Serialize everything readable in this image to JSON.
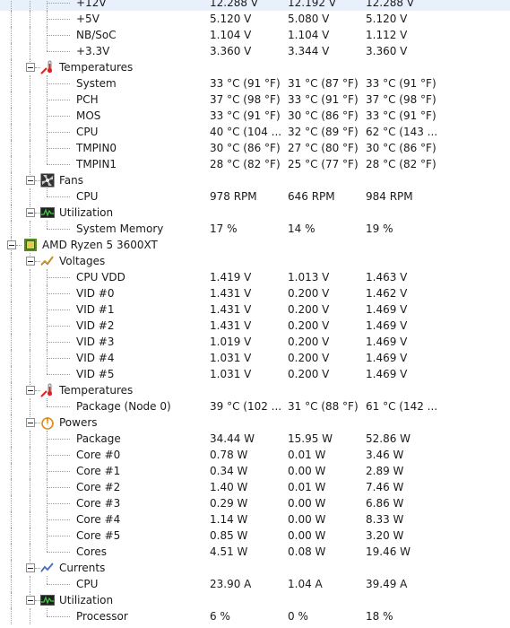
{
  "rows": [
    {
      "type": "data",
      "indent": 2,
      "label": "+12V",
      "values": [
        "12.288 V",
        "12.192 V",
        "12.288 V"
      ]
    },
    {
      "type": "data",
      "indent": 2,
      "label": "+5V",
      "values": [
        "5.120 V",
        "5.080 V",
        "5.120 V"
      ]
    },
    {
      "type": "data",
      "indent": 2,
      "label": "NB/SoC",
      "values": [
        "1.104 V",
        "1.104 V",
        "1.112 V"
      ]
    },
    {
      "type": "data",
      "indent": 2,
      "label": "+3.3V",
      "values": [
        "3.360 V",
        "3.344 V",
        "3.360 V"
      ]
    },
    {
      "type": "group",
      "indent": 1,
      "icon": "thermometer-icon",
      "label": "Temperatures"
    },
    {
      "type": "data",
      "indent": 2,
      "label": "System",
      "values": [
        "33 °C  (91 °F)",
        "31 °C  (87 °F)",
        "33 °C  (91 °F)"
      ]
    },
    {
      "type": "data",
      "indent": 2,
      "label": "PCH",
      "values": [
        "37 °C  (98 °F)",
        "33 °C  (91 °F)",
        "37 °C  (98 °F)"
      ]
    },
    {
      "type": "data",
      "indent": 2,
      "label": "MOS",
      "values": [
        "33 °C  (91 °F)",
        "30 °C  (86 °F)",
        "33 °C  (91 °F)"
      ]
    },
    {
      "type": "data",
      "indent": 2,
      "label": "CPU",
      "values": [
        "40 °C  (104 ...",
        "32 °C  (89 °F)",
        "62 °C  (143 ..."
      ]
    },
    {
      "type": "data",
      "indent": 2,
      "label": "TMPIN0",
      "values": [
        "30 °C  (86 °F)",
        "27 °C  (80 °F)",
        "30 °C  (86 °F)"
      ]
    },
    {
      "type": "data",
      "indent": 2,
      "label": "TMPIN1",
      "values": [
        "28 °C  (82 °F)",
        "25 °C  (77 °F)",
        "28 °C  (82 °F)"
      ]
    },
    {
      "type": "group",
      "indent": 1,
      "icon": "fan-icon",
      "label": "Fans"
    },
    {
      "type": "data",
      "indent": 2,
      "label": "CPU",
      "values": [
        "978 RPM",
        "646 RPM",
        "984 RPM"
      ]
    },
    {
      "type": "group",
      "indent": 1,
      "icon": "utilization-icon",
      "label": "Utilization"
    },
    {
      "type": "data",
      "indent": 2,
      "label": "System Memory",
      "values": [
        "17 %",
        "14 %",
        "19 %"
      ]
    },
    {
      "type": "group",
      "indent": 0,
      "icon": "cpu-chip-icon",
      "label": "AMD Ryzen 5 3600XT"
    },
    {
      "type": "group",
      "indent": 1,
      "icon": "voltage-icon",
      "label": "Voltages"
    },
    {
      "type": "data",
      "indent": 2,
      "label": "CPU VDD",
      "values": [
        "1.419 V",
        "1.013 V",
        "1.463 V"
      ]
    },
    {
      "type": "data",
      "indent": 2,
      "label": "VID #0",
      "values": [
        "1.431 V",
        "0.200 V",
        "1.462 V"
      ]
    },
    {
      "type": "data",
      "indent": 2,
      "label": "VID #1",
      "values": [
        "1.431 V",
        "0.200 V",
        "1.469 V"
      ]
    },
    {
      "type": "data",
      "indent": 2,
      "label": "VID #2",
      "values": [
        "1.431 V",
        "0.200 V",
        "1.469 V"
      ]
    },
    {
      "type": "data",
      "indent": 2,
      "label": "VID #3",
      "values": [
        "1.019 V",
        "0.200 V",
        "1.469 V"
      ]
    },
    {
      "type": "data",
      "indent": 2,
      "label": "VID #4",
      "values": [
        "1.031 V",
        "0.200 V",
        "1.469 V"
      ]
    },
    {
      "type": "data",
      "indent": 2,
      "label": "VID #5",
      "values": [
        "1.031 V",
        "0.200 V",
        "1.469 V"
      ]
    },
    {
      "type": "group",
      "indent": 1,
      "icon": "thermometer-icon",
      "label": "Temperatures"
    },
    {
      "type": "data",
      "indent": 2,
      "label": "Package (Node 0)",
      "values": [
        "39 °C  (102 ...",
        "31 °C  (88 °F)",
        "61 °C  (142 ..."
      ]
    },
    {
      "type": "group",
      "indent": 1,
      "icon": "power-icon",
      "label": "Powers"
    },
    {
      "type": "data",
      "indent": 2,
      "label": "Package",
      "values": [
        "34.44 W",
        "15.95 W",
        "52.86 W"
      ]
    },
    {
      "type": "data",
      "indent": 2,
      "label": "Core #0",
      "values": [
        "0.78 W",
        "0.01 W",
        "3.46 W"
      ]
    },
    {
      "type": "data",
      "indent": 2,
      "label": "Core #1",
      "values": [
        "0.34 W",
        "0.00 W",
        "2.89 W"
      ]
    },
    {
      "type": "data",
      "indent": 2,
      "label": "Core #2",
      "values": [
        "1.40 W",
        "0.01 W",
        "7.46 W"
      ]
    },
    {
      "type": "data",
      "indent": 2,
      "label": "Core #3",
      "values": [
        "0.29 W",
        "0.00 W",
        "6.86 W"
      ]
    },
    {
      "type": "data",
      "indent": 2,
      "label": "Core #4",
      "values": [
        "1.14 W",
        "0.00 W",
        "8.33 W"
      ]
    },
    {
      "type": "data",
      "indent": 2,
      "label": "Core #5",
      "values": [
        "0.85 W",
        "0.00 W",
        "3.20 W"
      ]
    },
    {
      "type": "data",
      "indent": 2,
      "label": "Cores",
      "values": [
        "4.51 W",
        "0.08 W",
        "19.46 W"
      ]
    },
    {
      "type": "group",
      "indent": 1,
      "icon": "current-icon",
      "label": "Currents"
    },
    {
      "type": "data",
      "indent": 2,
      "label": "CPU",
      "values": [
        "23.90 A",
        "1.04 A",
        "39.49 A"
      ]
    },
    {
      "type": "group",
      "indent": 1,
      "icon": "utilization-icon",
      "label": "Utilization"
    },
    {
      "type": "data",
      "indent": 2,
      "label": "Processor",
      "values": [
        "6 %",
        "0 %",
        "18 %"
      ]
    }
  ]
}
